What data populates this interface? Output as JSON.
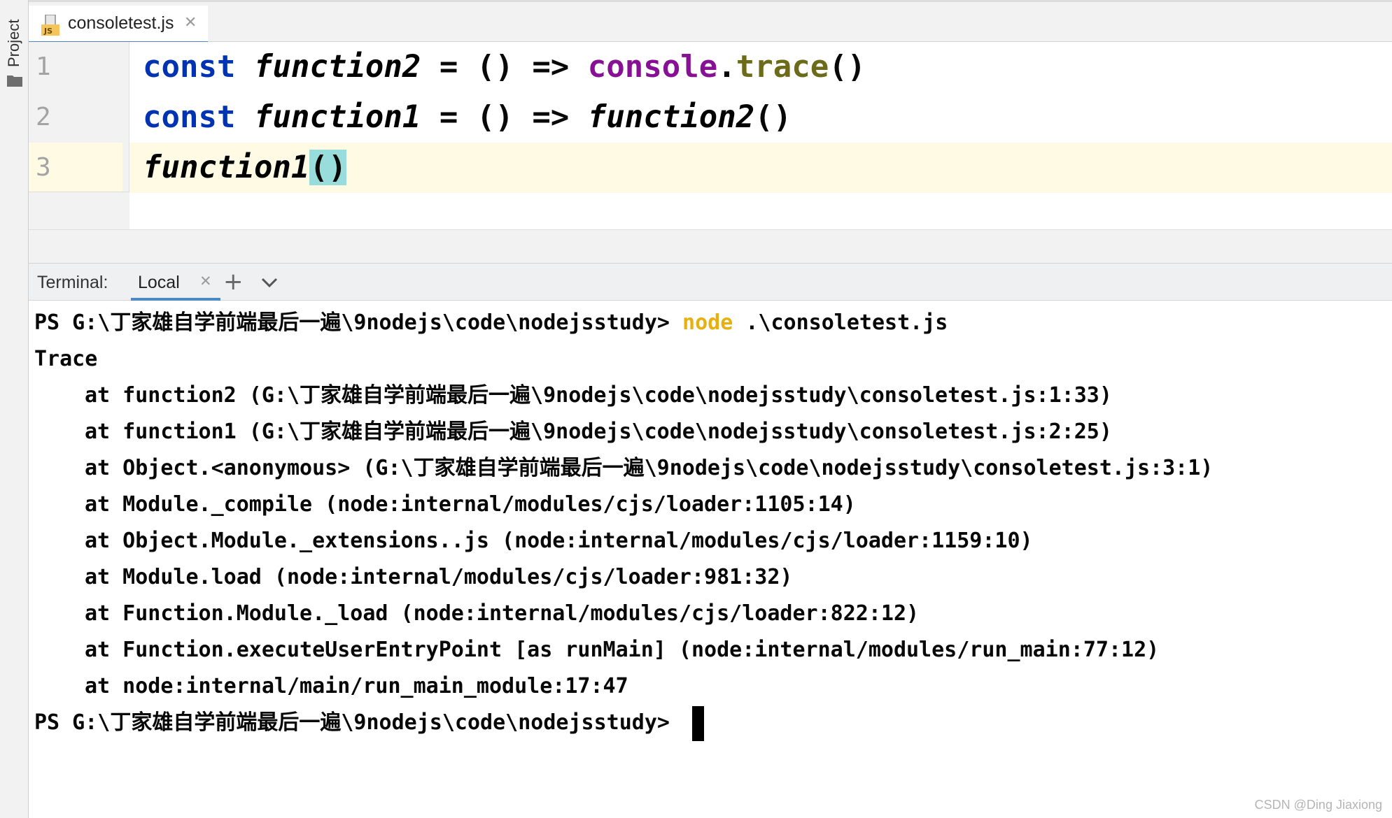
{
  "sidebar": {
    "project_label": "Project"
  },
  "editor": {
    "tab": {
      "filename": "consoletest.js",
      "close_glyph": "✕"
    },
    "lines": [
      {
        "number": "1",
        "tokens": [
          "const",
          " ",
          "function2",
          " = () => ",
          "console",
          ".",
          "trace",
          "()"
        ]
      },
      {
        "number": "2",
        "tokens": [
          "const",
          " ",
          "function1",
          " = () => ",
          "function2",
          "()"
        ]
      },
      {
        "number": "3",
        "tokens": [
          "function1",
          "(",
          ")"
        ]
      }
    ],
    "current_line": 3
  },
  "terminal": {
    "title": "Terminal:",
    "tab_label": "Local",
    "close_glyph": "✕",
    "new_tab_glyph": "+",
    "prompt_1": {
      "prefix": "PS G:\\丁家雄自学前端最后一遍\\9nodejs\\code\\nodejsstudy> ",
      "command": "node",
      "args": " .\\consoletest.js"
    },
    "output": [
      "Trace",
      "at function2 (G:\\丁家雄自学前端最后一遍\\9nodejs\\code\\nodejsstudy\\consoletest.js:1:33)",
      "at function1 (G:\\丁家雄自学前端最后一遍\\9nodejs\\code\\nodejsstudy\\consoletest.js:2:25)",
      "at Object.<anonymous> (G:\\丁家雄自学前端最后一遍\\9nodejs\\code\\nodejsstudy\\consoletest.js:3:1)",
      "at Module._compile (node:internal/modules/cjs/loader:1105:14)",
      "at Object.Module._extensions..js (node:internal/modules/cjs/loader:1159:10)",
      "at Module.load (node:internal/modules/cjs/loader:981:32)",
      "at Function.Module._load (node:internal/modules/cjs/loader:822:12)",
      "at Function.executeUserEntryPoint [as runMain] (node:internal/modules/run_main:77:12)",
      "at node:internal/main/run_main_module:17:47"
    ],
    "prompt_2": "PS G:\\丁家雄自学前端最后一遍\\9nodejs\\code\\nodejsstudy> "
  },
  "watermark": "CSDN @Ding Jiaxiong",
  "colors": {
    "keyword": "#0033b3",
    "global": "#871094",
    "method": "#6c6b19",
    "node_command": "#e8b00e",
    "tab_underline": "#4a88c7",
    "current_line_bg": "#fffae3",
    "paren_match_bg": "#99dcdc"
  },
  "icons": [
    "folder-icon",
    "js-file-icon",
    "close-icon",
    "plus-icon",
    "chevron-down-icon"
  ]
}
